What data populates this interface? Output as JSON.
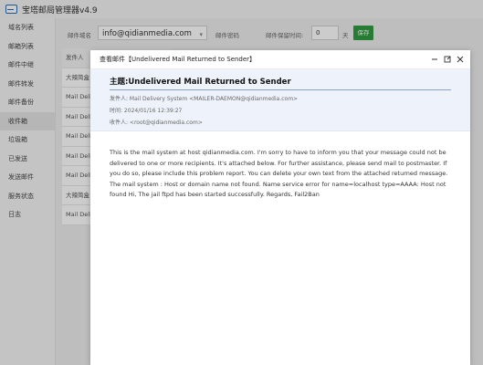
{
  "app": {
    "title": "宝塔邮局管理器v4.9"
  },
  "sidebar": {
    "items": [
      {
        "label": "域名列表"
      },
      {
        "label": "邮箱列表"
      },
      {
        "label": "邮件中继"
      },
      {
        "label": "邮件转发"
      },
      {
        "label": "邮件备份"
      },
      {
        "label": "收件箱"
      },
      {
        "label": "垃圾箱"
      },
      {
        "label": "已发送"
      },
      {
        "label": "发送邮件"
      },
      {
        "label": "服务状态"
      },
      {
        "label": "日志"
      }
    ]
  },
  "toolbar": {
    "domain_label": "邮件域名",
    "domain_value": "info@qidianmedia.com",
    "password_label": "邮件密码",
    "retention_label": "邮件保留时间:",
    "retention_value": "0",
    "retention_unit": "天",
    "save_label": "保存"
  },
  "list": {
    "header": "发件人",
    "rows": [
      "大辣简盒",
      "Mail Deliv",
      "Mail Deliv",
      "Mail Deliv",
      "Mail Deliv",
      "Mail Deliv",
      "大辣简盒",
      "Mail Deliv"
    ]
  },
  "dialog": {
    "title": "查看邮件【Undelivered Mail Returned to Sender】",
    "subject": "主题:Undelivered Mail Returned to Sender",
    "from": "发件人: Mail Delivery System <MAILER-DAEMON@qidianmedia.com>",
    "time": "时间: 2024/01/16 12:39:27",
    "to": "收件人: <root@qidianmedia.com>",
    "body": "This is the mail system at host qidianmedia.com. I'm sorry to have to inform you that your message could not be delivered to one or more recipients. It's attached below. For further assistance, please send mail to postmaster. If you do so, please include this problem report. You can delete your own text from the attached returned message. The mail system : Host or domain name not found. Name service error for name=localhost type=AAAA: Host not found Hi, The jail ftpd has been started successfully. Regards, Fail2Ban"
  },
  "colors": {
    "accent_green": "#2f9c3f",
    "meta_background": "#eef3fb"
  }
}
